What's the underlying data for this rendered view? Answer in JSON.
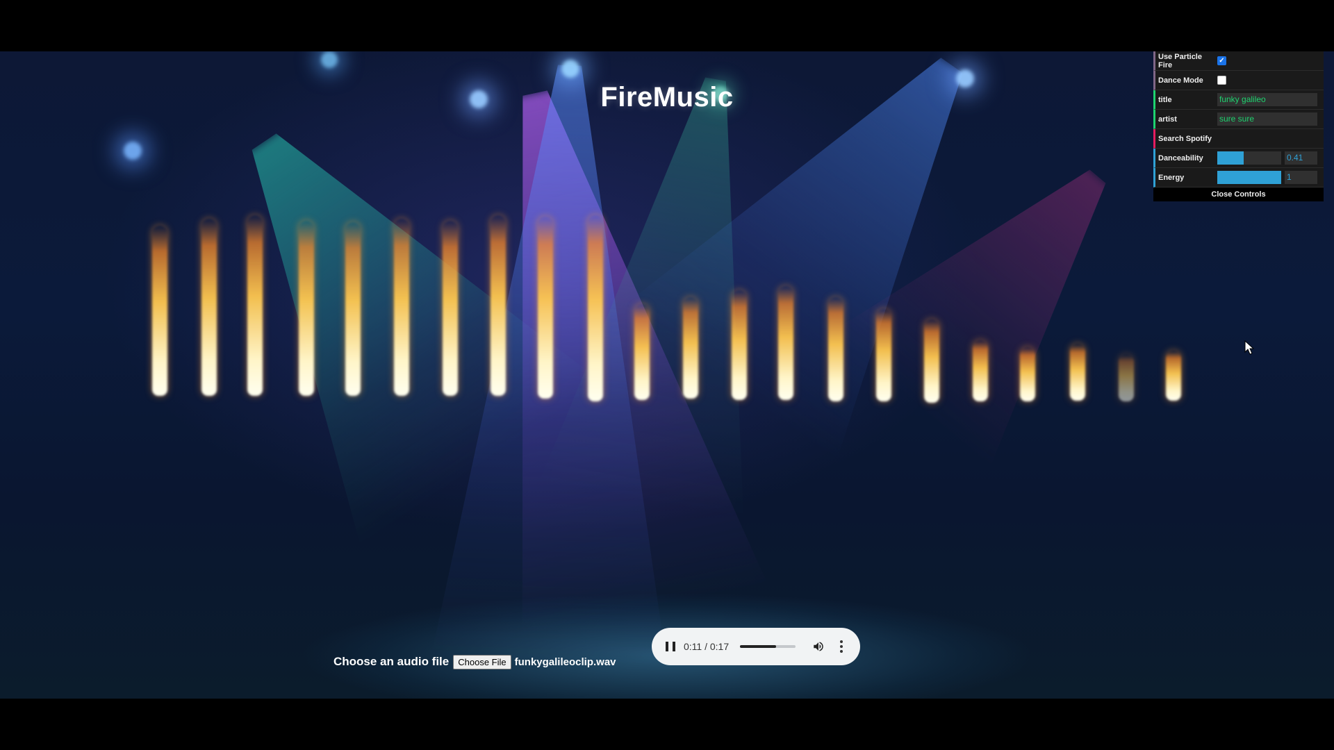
{
  "app": {
    "title": "FireMusic"
  },
  "controls": {
    "use_particle_fire": {
      "label": "Use Particle Fire",
      "checked": true
    },
    "dance_mode": {
      "label": "Dance Mode",
      "checked": false
    },
    "title_field": {
      "label": "title",
      "value": "funky galileo"
    },
    "artist_field": {
      "label": "artist",
      "value": "sure sure"
    },
    "search_spotify": {
      "label": "Search Spotify"
    },
    "danceability": {
      "label": "Danceability",
      "value": "0.41",
      "fraction": 0.41
    },
    "energy": {
      "label": "Energy",
      "value": "1",
      "fraction": 1.0
    },
    "close_label": "Close Controls"
  },
  "file_picker": {
    "label": "Choose an audio file",
    "button_label": "Choose File",
    "file_name": "funkygalileoclip.wav"
  },
  "audio_player": {
    "time": "0:11 / 0:17",
    "progress_fraction": 0.647
  },
  "colors": {
    "accent_blue": "#2fa1d6",
    "string_green": "#1ed36f",
    "function_pink": "#e61d5f",
    "boolean_purple": "#806787"
  },
  "icons": [
    "pause-icon",
    "volume-icon",
    "more-options-icon",
    "mouse-cursor-icon"
  ]
}
